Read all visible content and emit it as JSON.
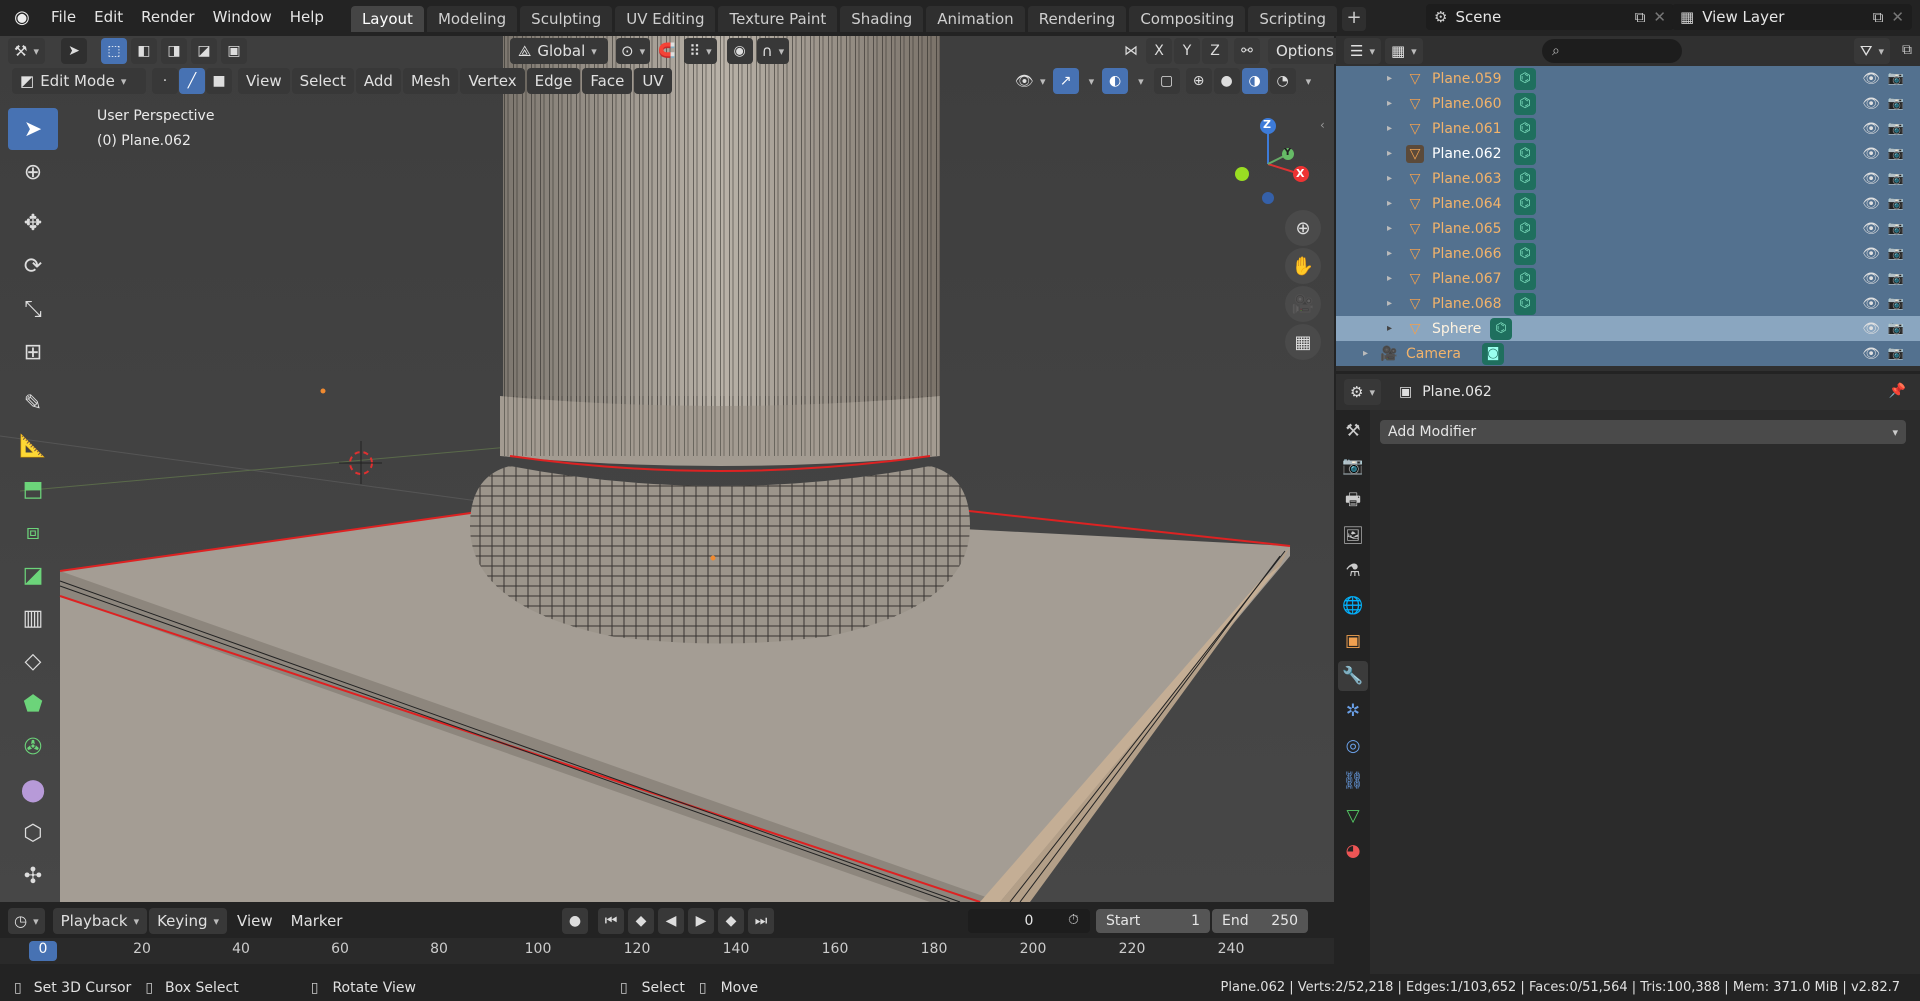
{
  "topbar": {
    "menus": [
      "File",
      "Edit",
      "Render",
      "Window",
      "Help"
    ],
    "workspaces": [
      "Layout",
      "Modeling",
      "Sculpting",
      "UV Editing",
      "Texture Paint",
      "Shading",
      "Animation",
      "Rendering",
      "Compositing",
      "Scripting"
    ],
    "active_workspace": "Layout",
    "scene": "Scene",
    "view_layer": "View Layer"
  },
  "viewport": {
    "orientation": "Global",
    "options": "Options",
    "axes": [
      "X",
      "Y",
      "Z"
    ],
    "mode": "Edit Mode",
    "menus": [
      "View",
      "Select",
      "Add",
      "Mesh",
      "Vertex",
      "Edge",
      "Face",
      "UV"
    ],
    "overlay_title": "User Perspective",
    "overlay_object": "(0) Plane.062",
    "gizmo": {
      "z": "Z",
      "y": "Y",
      "x": "X"
    }
  },
  "outliner": {
    "items": [
      {
        "name": "Plane.059"
      },
      {
        "name": "Plane.060"
      },
      {
        "name": "Plane.061"
      },
      {
        "name": "Plane.062"
      },
      {
        "name": "Plane.063"
      },
      {
        "name": "Plane.064"
      },
      {
        "name": "Plane.065"
      },
      {
        "name": "Plane.066"
      },
      {
        "name": "Plane.067"
      },
      {
        "name": "Plane.068"
      },
      {
        "name": "Sphere"
      }
    ],
    "camera": "Camera"
  },
  "properties": {
    "object": "Plane.062",
    "add_modifier": "Add Modifier"
  },
  "timeline": {
    "menus": [
      "Playback",
      "Keying",
      "View",
      "Marker"
    ],
    "current_frame": "0",
    "start_label": "Start",
    "start": "1",
    "end_label": "End",
    "end": "250",
    "ticks": [
      "0",
      "20",
      "40",
      "60",
      "80",
      "100",
      "120",
      "140",
      "160",
      "180",
      "200",
      "220",
      "240"
    ]
  },
  "statusbar": {
    "hint1": "Set 3D Cursor",
    "hint2": "Box Select",
    "hint3": "Rotate View",
    "hint4": "Select",
    "hint5": "Move",
    "stats": "Plane.062 | Verts:2/52,218 | Edges:1/103,652 | Faces:0/51,564 | Tris:100,388 | Mem: 371.0 MiB | v2.82.7"
  },
  "colors": {
    "accent": "#4772b3",
    "selection_row": "#53718f",
    "object_name": "#f2b36b",
    "edge_selected": "#e03030"
  }
}
